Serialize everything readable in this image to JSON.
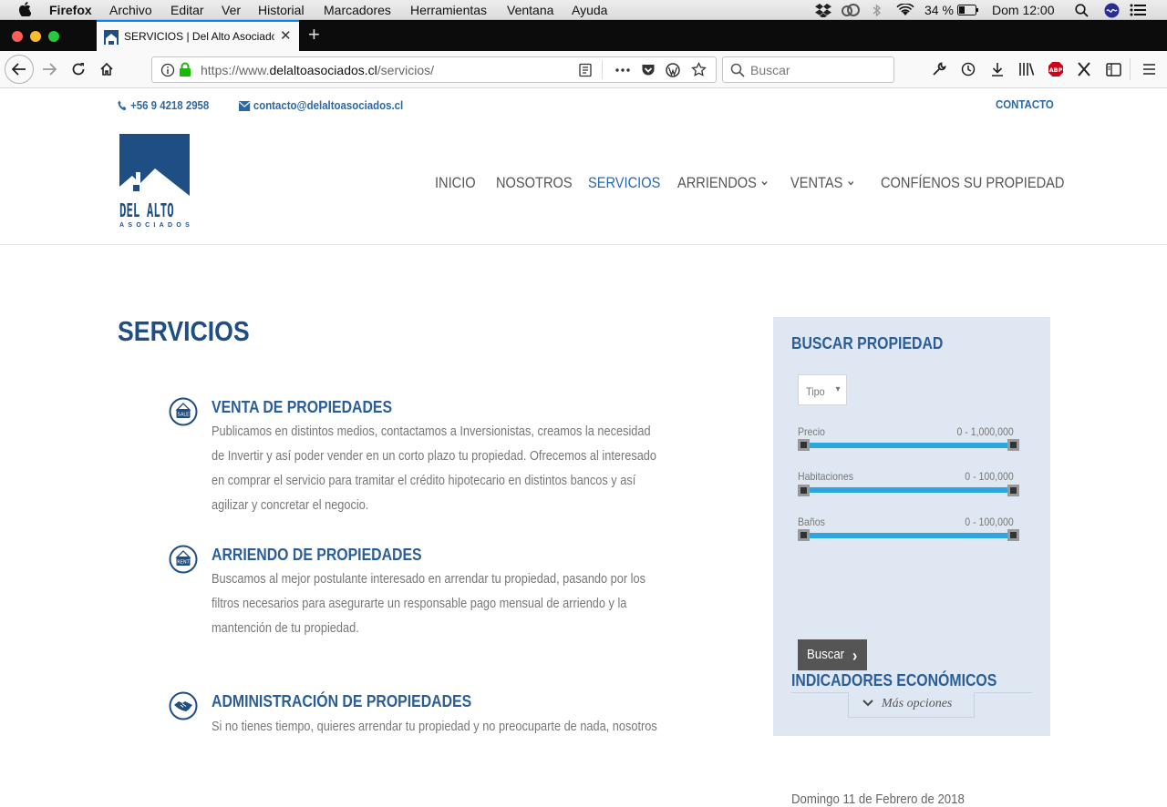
{
  "menubar": {
    "app": "Firefox",
    "menus": [
      "Archivo",
      "Editar",
      "Ver",
      "Historial",
      "Marcadores",
      "Herramientas",
      "Ventana",
      "Ayuda"
    ],
    "battery": "34 %",
    "clock": "Dom 12:00"
  },
  "browser": {
    "tab_title": "SERVICIOS | Del Alto Asociados",
    "url_prefix": "https://www.",
    "url_domain": "delaltoasociados.cl",
    "url_path": "/servicios/",
    "search_placeholder": "Buscar"
  },
  "site": {
    "phone": "+56 9 4218 2958",
    "email": "contacto@delaltoasociados.cl",
    "top_link": "CONTACTO",
    "logo_line1": "DEL ALTO",
    "logo_line2": "ASOCIADOS",
    "nav": [
      "INICIO",
      "NOSOTROS",
      "SERVICIOS",
      "ARRIENDOS",
      "VENTAS",
      "CONFÍENOS SU PROPIEDAD"
    ],
    "page_title": "SERVICIOS",
    "services": [
      {
        "title": "VENTA DE PROPIEDADES",
        "icon_label": "SALE",
        "text": "Publicamos en distintos medios, contactamos a Inversionistas, creamos la necesidad de Invertir y así poder vender en un corto plazo tu propiedad. Ofrecemos al interesado en comprar el servicio para tramitar el crédito hipotecario en distintos bancos y así agilizar y concretar el negocio."
      },
      {
        "title": "ARRIENDO DE PROPIEDADES",
        "icon_label": "RENT",
        "text": "Buscamos al mejor postulante interesado en arrendar tu propiedad, pasando por los filtros necesarios para asegurarte un responsable pago mensual de arriendo y la mantención de tu propiedad."
      },
      {
        "title": "ADMINISTRACIÓN DE PROPIEDADES",
        "text": "Si no tienes tiempo, quieres arrendar tu propiedad y no preocuparte de nada, nosotros"
      }
    ],
    "sidebar": {
      "search_title": "BUSCAR PROPIEDAD",
      "tipo": "Tipo",
      "ranges": [
        {
          "label": "Precio",
          "value": "0 - 1,000,000"
        },
        {
          "label": "Habitaciones",
          "value": "0 - 100,000"
        },
        {
          "label": "Baños",
          "value": "0 - 100,000"
        }
      ],
      "search_button": "Buscar",
      "more_options": "Más opciones",
      "indicators_title": "INDICADORES ECONÓMICOS",
      "date": "Domingo 11 de Febrero de 2018"
    }
  },
  "colors": {
    "brand_blue": "#1f4e85",
    "link_blue": "#2b68a6",
    "slider_blue": "#2ba6df",
    "sidebar_bg": "#dfe8f2"
  }
}
